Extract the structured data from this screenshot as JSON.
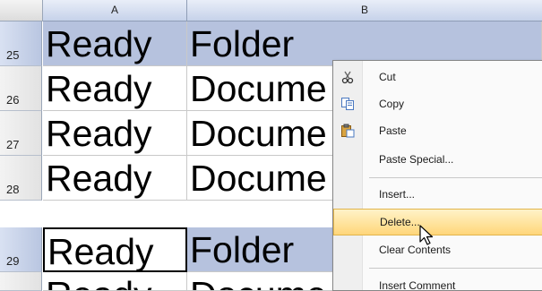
{
  "columns": {
    "a": "A",
    "b": "B"
  },
  "rows": [
    {
      "num": "25",
      "a": "Ready",
      "b": "Folder"
    },
    {
      "num": "26",
      "a": "Ready",
      "b": "Docume"
    },
    {
      "num": "27",
      "a": "Ready",
      "b": "Docume"
    },
    {
      "num": "28",
      "a": "Ready",
      "b": "Docume"
    },
    {
      "num": "29",
      "a": "Ready",
      "b": "Folder"
    },
    {
      "num": "",
      "a": "Ready",
      "b": "Docume"
    }
  ],
  "context_menu": {
    "items": [
      {
        "label": "Cut",
        "icon": "scissors-icon"
      },
      {
        "label": "Copy",
        "icon": "copy-icon"
      },
      {
        "label": "Paste",
        "icon": "paste-icon"
      },
      {
        "label": "Paste Special...",
        "icon": ""
      },
      {
        "label": "Insert...",
        "icon": ""
      },
      {
        "label": "Delete...",
        "icon": ""
      },
      {
        "label": "Clear Contents",
        "icon": ""
      },
      {
        "label": "Insert Comment",
        "icon": ""
      }
    ],
    "highlighted": "Delete..."
  },
  "colors": {
    "selection": "#b6c2de",
    "menu_highlight": "#ffd67a"
  }
}
